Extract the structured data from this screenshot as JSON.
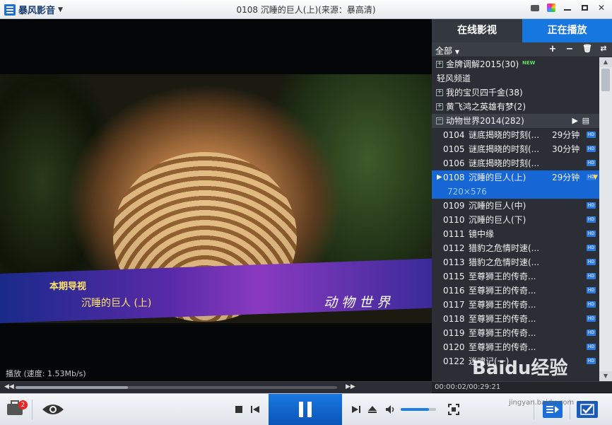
{
  "app": {
    "name": "暴风影音",
    "window_title": "0108 沉睡的巨人(上)(来源：暴高清)"
  },
  "video": {
    "caption_header": "本期导视",
    "caption_title": "沉睡的巨人  (上)",
    "channel_logo": "动物世界",
    "status": "播放 (速度: 1.53Mb/s)"
  },
  "seek": {
    "progress": 0.35,
    "time": "00:00:02/00:29:21"
  },
  "controls": {
    "toolbox_badge": "2",
    "volume": 0.8
  },
  "panel": {
    "tabs": [
      "在线影视",
      "正在播放"
    ],
    "active_tab": 1,
    "filter_label": "全部",
    "groups": [
      {
        "label": "金牌调解2015(30)",
        "new": "NEW"
      },
      {
        "label": "轻风频道"
      },
      {
        "label": "我的宝贝四千金(38)"
      },
      {
        "label": "黄飞鸿之英雄有梦(2)"
      },
      {
        "label": "动物世界2014(282)"
      }
    ],
    "episodes": [
      {
        "code": "0104",
        "title": "谜底揭晓的时刻(...",
        "duration": "29分钟"
      },
      {
        "code": "0105",
        "title": "谜底揭晓的时刻(...",
        "duration": "30分钟"
      },
      {
        "code": "0106",
        "title": "谜底揭晓的时刻(...",
        "duration": ""
      },
      {
        "code": "0108",
        "title": "沉睡的巨人(上)",
        "duration": "29分钟",
        "resolution": "720×576"
      },
      {
        "code": "0109",
        "title": "沉睡的巨人(中)",
        "duration": ""
      },
      {
        "code": "0110",
        "title": "沉睡的巨人(下)",
        "duration": ""
      },
      {
        "code": "0111",
        "title": "镜中缘",
        "duration": ""
      },
      {
        "code": "0112",
        "title": "猎豹之危情时速(...",
        "duration": ""
      },
      {
        "code": "0113",
        "title": "猎豹之危情时速(...",
        "duration": ""
      },
      {
        "code": "0115",
        "title": "至尊狮王的传奇...",
        "duration": ""
      },
      {
        "code": "0116",
        "title": "至尊狮王的传奇...",
        "duration": ""
      },
      {
        "code": "0117",
        "title": "至尊狮王的传奇...",
        "duration": ""
      },
      {
        "code": "0118",
        "title": "至尊狮王的传奇...",
        "duration": ""
      },
      {
        "code": "0119",
        "title": "至尊狮王的传奇...",
        "duration": ""
      },
      {
        "code": "0120",
        "title": "至尊狮王的传奇...",
        "duration": ""
      },
      {
        "code": "0122",
        "title": "迷魂记(一)",
        "duration": ""
      }
    ],
    "hd_label": "HD"
  },
  "watermark": {
    "text": "Baidu经验",
    "url": "jingyan.baidu.com"
  }
}
